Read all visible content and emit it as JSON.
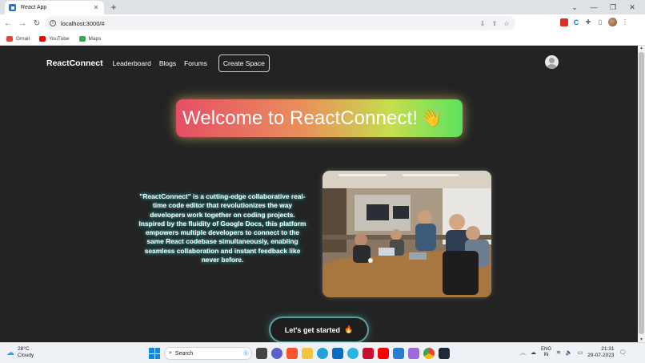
{
  "browser": {
    "tab_title": "React App",
    "tab_close": "✕",
    "new_tab": "+",
    "url": "localhost:3000/#",
    "bookmarks": [
      {
        "label": "Gmail",
        "color": "#ea4335"
      },
      {
        "label": "YouTube",
        "color": "#ff0000"
      },
      {
        "label": "Maps",
        "color": "#34a853"
      }
    ]
  },
  "nav": {
    "brand": "ReactConnect",
    "links": [
      "Leaderboard",
      "Blogs",
      "Forums"
    ],
    "create_space": "Create Space"
  },
  "hero": {
    "title": "Welcome to ReactConnect!",
    "emoji": "👋"
  },
  "description": "\"ReactConnect\" is a cutting-edge collaborative real-time code editor that revolutionizes the way developers work together on coding projects. Inspired by the fluidity of Google Docs, this platform empowers multiple developers to connect to the same React codebase simultaneously, enabling seamless collaboration and instant feedback like never before.",
  "cta": {
    "label": "Let's get started",
    "emoji": "🔥"
  },
  "taskbar": {
    "temperature": "28°C",
    "condition": "Cloudy",
    "search_label": "Search",
    "lang_line1": "ENG",
    "lang_line2": "IN",
    "time": "21:31",
    "date": "29-07-2023"
  },
  "colors": {
    "page_bg": "#232323",
    "hero_start": "#e64e66",
    "hero_end": "#5de25e",
    "glow": "#2fa7a0"
  }
}
